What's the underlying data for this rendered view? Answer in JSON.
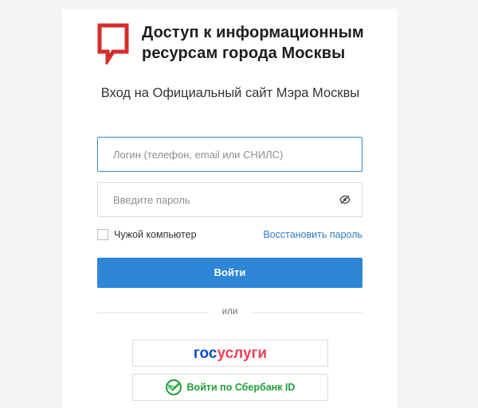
{
  "brand": {
    "title": "Доступ к информационным ресурсам города Москвы",
    "logo_icon": "mos-speech-bubble-logo",
    "logo_color": "#d62d2d"
  },
  "subtitle": "Вход на Официальный сайт Мэра Москвы",
  "login_field": {
    "placeholder": "Логин (телефон, email или СНИЛС)",
    "value": ""
  },
  "password_field": {
    "placeholder": "Введите пароль",
    "value": "",
    "toggle_icon": "eye-hidden-icon"
  },
  "remember": {
    "label": "Чужой компьютер",
    "checked": false
  },
  "restore_link": "Восстановить пароль",
  "login_button": "Войти",
  "divider_text": "или",
  "gosuslugi": {
    "part1": "гос",
    "part2": "услуги",
    "color1": "#0d4cd3",
    "color2": "#ee3f58"
  },
  "sber": {
    "label": "Войти по Сбербанк ID",
    "color": "#21a038",
    "icon": "sber-logo-icon"
  },
  "colors": {
    "accent": "#2f86d6",
    "link": "#2e7cc7",
    "focus_border": "#3f87cc"
  }
}
